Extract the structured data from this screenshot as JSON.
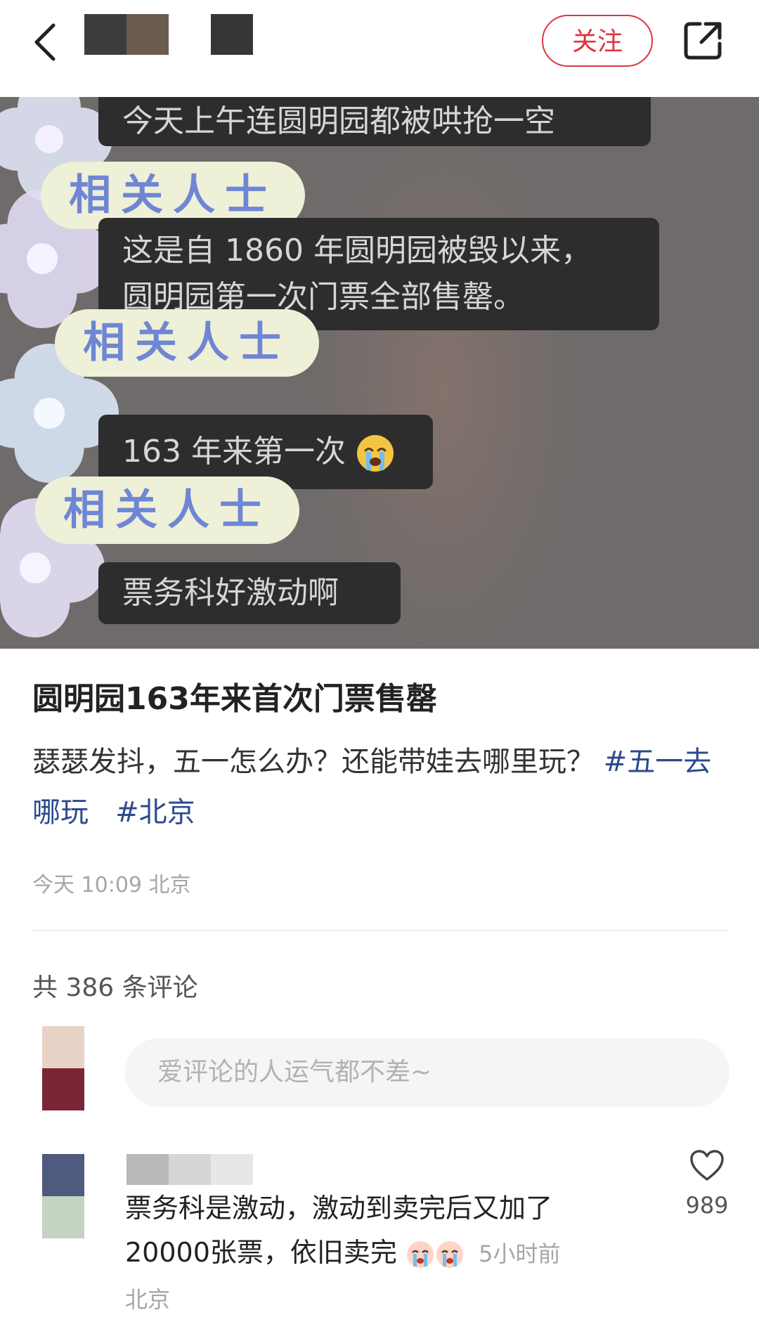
{
  "header": {
    "follow_label": "关注",
    "back_icon": "chevron-left-icon",
    "share_icon": "share-icon"
  },
  "image": {
    "bubble_1": "今天上午连圆明园都被哄抢一空",
    "tag_1": "相关人士",
    "bubble_2_line1": "这是自 1860 年圆明园被毁以来，",
    "bubble_2_line2": "圆明园第一次门票全部售罄。",
    "tag_2": "相关人士",
    "bubble_3": "163 年来第一次",
    "tag_3": "相关人士",
    "bubble_4": "票务科好激动啊"
  },
  "post": {
    "title": "圆明园163年来首次门票售罄",
    "description": "瑟瑟发抖，五一怎么办？还能带娃去哪里玩？",
    "hashtag_1": "#五一去哪玩",
    "hashtag_2": "#北京",
    "time_location": "今天 10:09 北京"
  },
  "comments": {
    "count_label": "共 386 条评论",
    "input_placeholder": "爱评论的人运气都不差~",
    "items": [
      {
        "text": "票务科是激动，激动到卖完后又加了20000张票，依旧卖完",
        "time_location": "5小时前 北京",
        "likes": "989"
      }
    ]
  },
  "colors": {
    "accent": "#e0333f",
    "hashtag": "#2c4a8c",
    "muted": "#a6a6a6"
  }
}
